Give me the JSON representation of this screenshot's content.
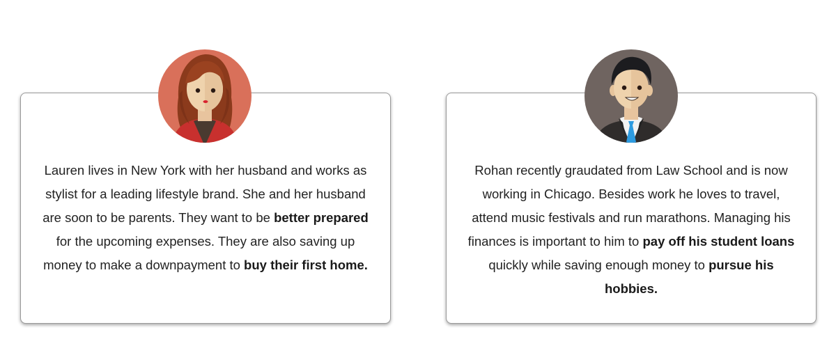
{
  "personas": [
    {
      "name": "Lauren",
      "bio_segments": [
        {
          "text": "Lauren lives in New York with her husband and works as stylist for a leading lifestyle brand. She and her husband are soon to be parents. They want to be "
        },
        {
          "text": "better prepared",
          "bold": true
        },
        {
          "text": " for the upcoming expenses. They are also saving up money to make a downpayment to "
        },
        {
          "text": "buy their first home.",
          "bold": true
        }
      ],
      "avatar_bg": "#d9705a"
    },
    {
      "name": "Rohan",
      "bio_segments": [
        {
          "text": "Rohan recently graudated from Law School and is now working in Chicago. Besides work he loves to travel, attend music festivals and run marathons. Managing his finances is important to him to "
        },
        {
          "text": "pay off his student loans",
          "bold": true
        },
        {
          "text": " quickly while saving enough money to "
        },
        {
          "text": "pursue his hobbies.",
          "bold": true
        }
      ],
      "avatar_bg": "#6f6460"
    }
  ]
}
